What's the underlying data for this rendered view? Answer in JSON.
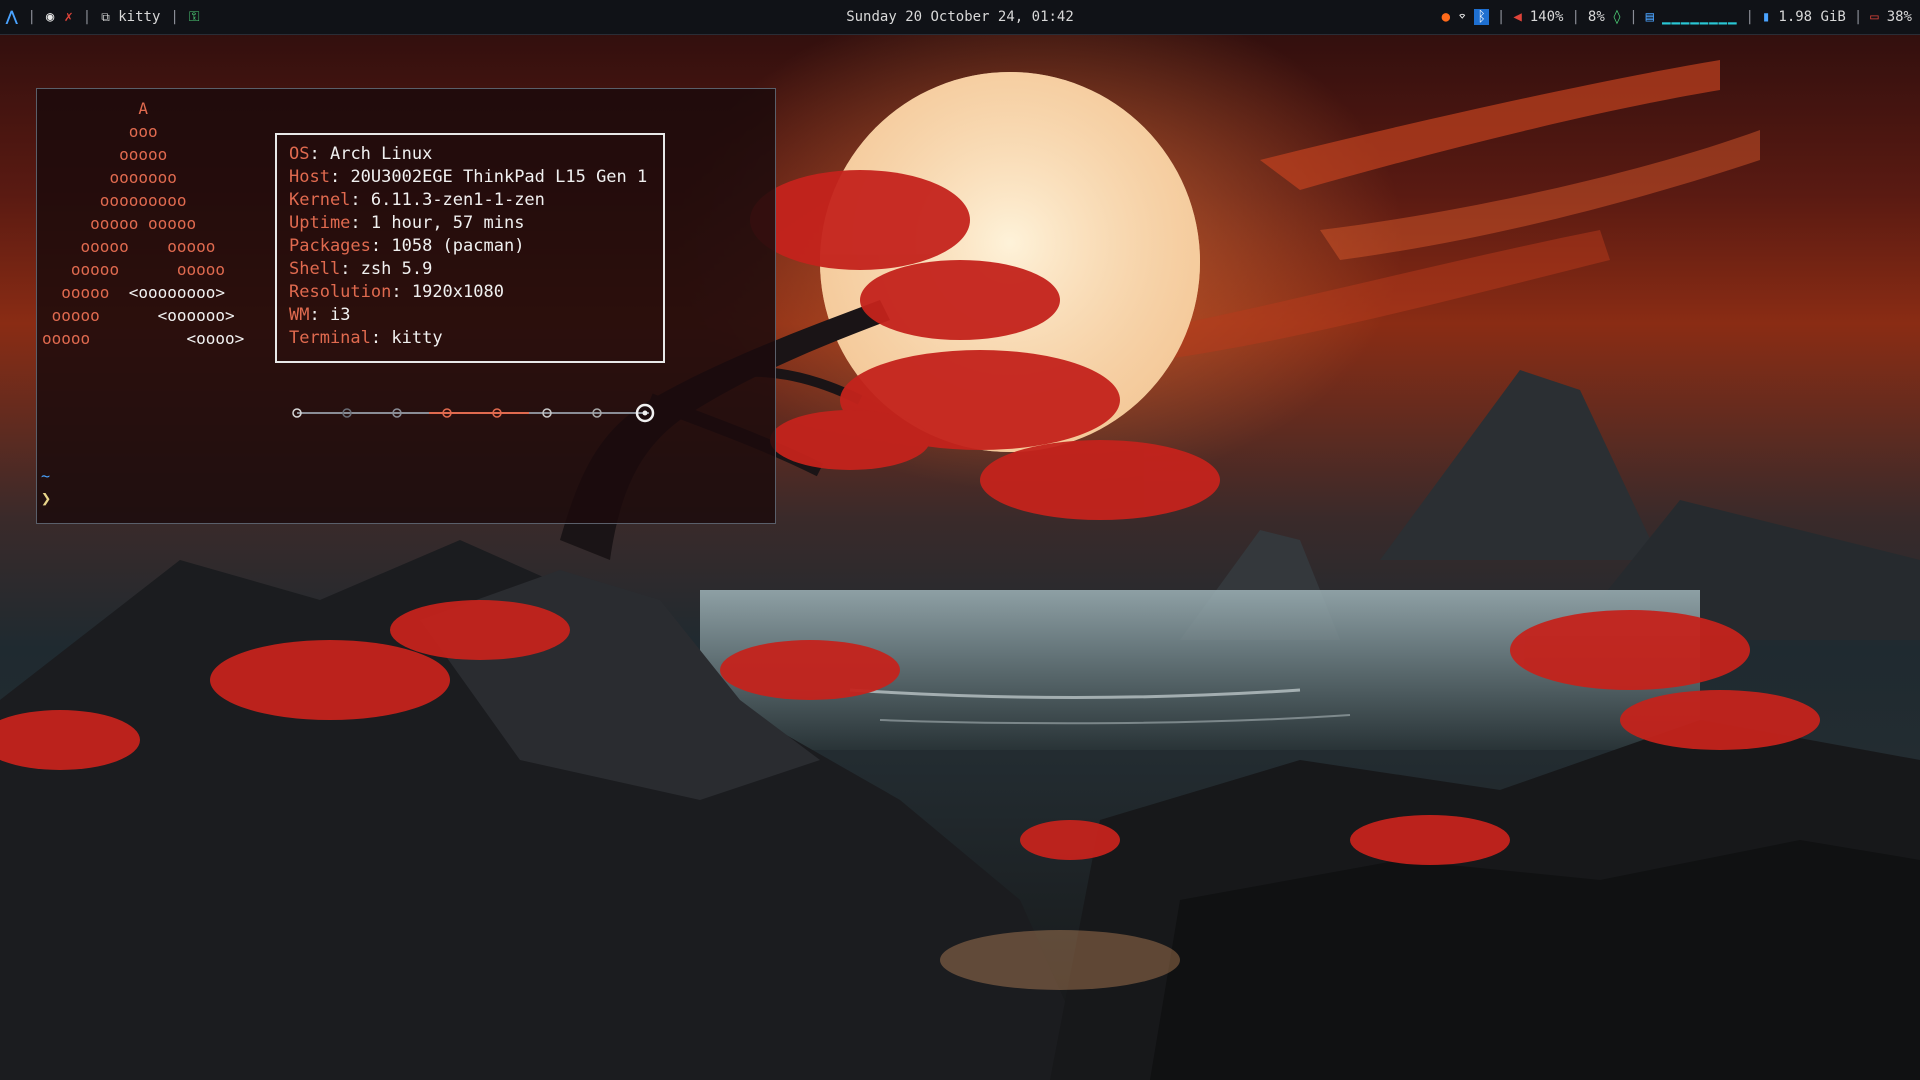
{
  "topbar": {
    "left": {
      "arch_icon": "arch-linux-icon",
      "workspace_icon": "circle-icon",
      "window_icon": "kitty-icon",
      "window_title": "kitty"
    },
    "clock": "Sunday 20 October 24, 01:42",
    "status": {
      "volume": "140%",
      "brightness": "8%",
      "cpu_graph": "▁▁▁▁▁▁▁▁",
      "memory": "1.98 GiB",
      "battery": "38%"
    }
  },
  "terminal": {
    "ascii_logo": [
      [
        "A",
        ""
      ],
      [
        "ooo",
        ""
      ],
      [
        "ooooo",
        ""
      ],
      [
        "ooooooo",
        ""
      ],
      [
        "ooooooooo",
        ""
      ],
      [
        "ooooo ooooo",
        ""
      ],
      [
        "ooooo    ooooo",
        ""
      ],
      [
        "ooooo      ooooo",
        ""
      ],
      [
        "ooooo  ",
        "<oooooooo>"
      ],
      [
        "ooooo      ",
        "<oooooo>"
      ],
      [
        "ooooo          ",
        "<oooo>"
      ]
    ],
    "info": [
      {
        "key": "OS",
        "value": "Arch Linux"
      },
      {
        "key": "Host",
        "value": "20U3002EGE ThinkPad L15 Gen 1"
      },
      {
        "key": "Kernel",
        "value": "6.11.3-zen1-1-zen"
      },
      {
        "key": "Uptime",
        "value": "1 hour, 57 mins"
      },
      {
        "key": "Packages",
        "value": "1058 (pacman)"
      },
      {
        "key": "Shell",
        "value": "zsh 5.9"
      },
      {
        "key": "Resolution",
        "value": "1920x1080"
      },
      {
        "key": "WM",
        "value": "i3"
      },
      {
        "key": "Terminal",
        "value": "kitty"
      }
    ],
    "prompt_dir": "~",
    "prompt_symbol": "❯"
  },
  "colors": {
    "accent_red": "#e06a4f",
    "bar_bg": "#101217",
    "arch_blue": "#4aa3ff"
  }
}
